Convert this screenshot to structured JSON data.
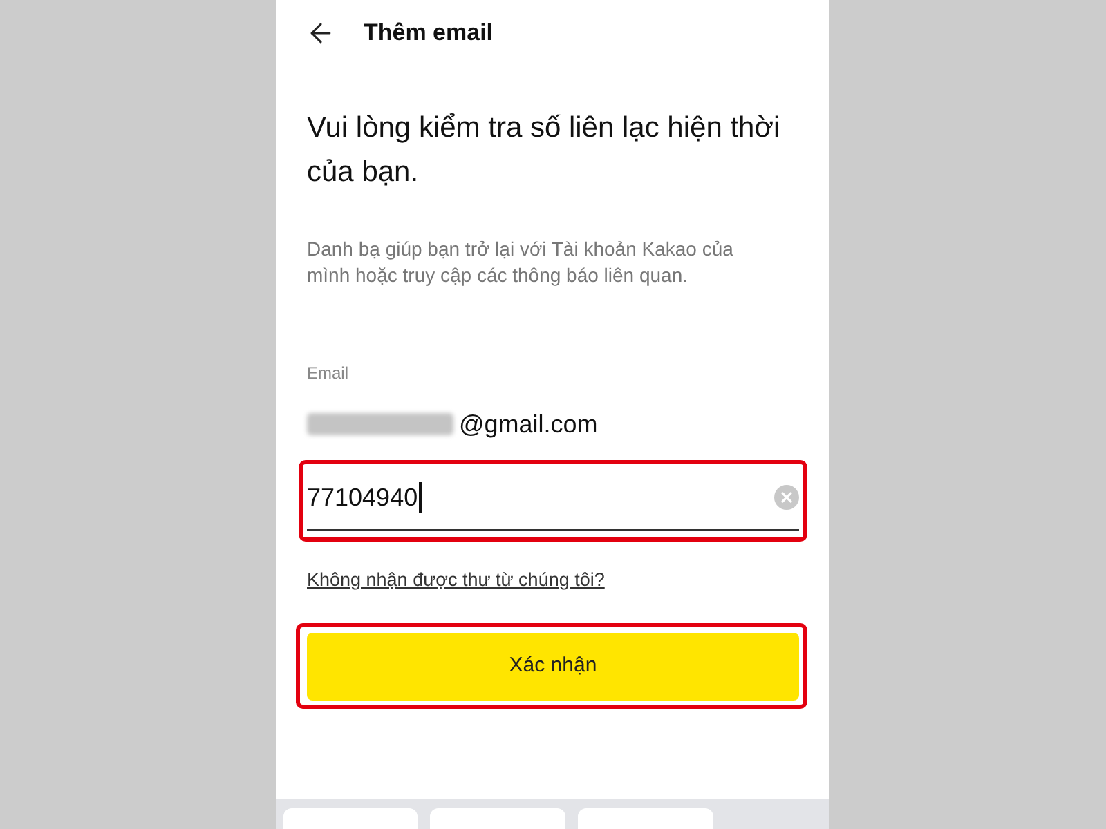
{
  "header": {
    "title": "Thêm email"
  },
  "heading": "Vui lòng kiểm tra số liên lạc hiện thời của bạn.",
  "description": "Danh bạ giúp bạn trở lại với Tài khoản Kakao của mình hoặc truy cập các thông báo liên quan.",
  "email": {
    "label": "Email",
    "value": "@gmail.com"
  },
  "code_field": {
    "value": "77104940",
    "focused": true,
    "highlighted": true
  },
  "resend_link": "Không nhận được thư từ chúng tôi?",
  "confirm_button": {
    "label": "Xác nhận",
    "highlighted": true
  }
}
